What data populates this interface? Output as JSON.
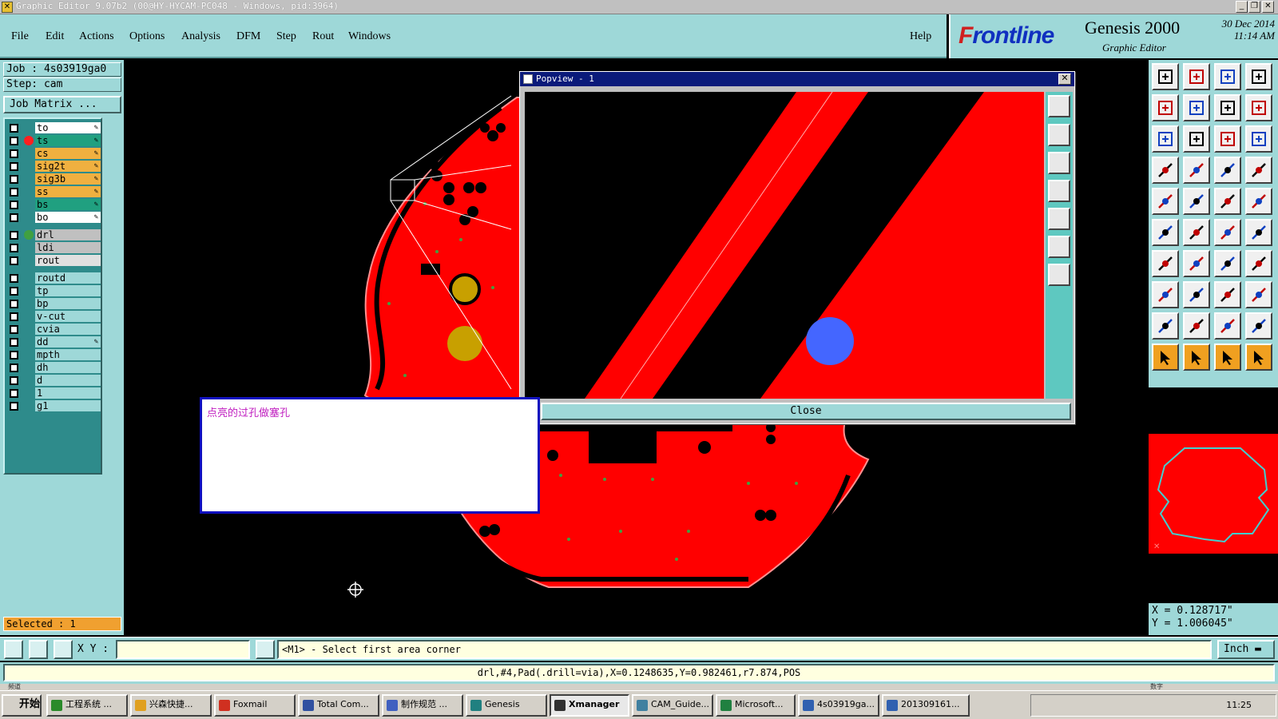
{
  "window": {
    "title": "Graphic Editor 9.07b2 (00@HY-HYCAM-PC048 - Windows, pid:3964)"
  },
  "menu": {
    "items": [
      "File",
      "Edit",
      "Actions",
      "Options",
      "Analysis",
      "DFM",
      "Step",
      "Rout",
      "Windows"
    ],
    "help": "Help"
  },
  "brand": {
    "logo_left": "F",
    "logo_right": "rontline",
    "product": "Genesis 2000",
    "subtitle": "Graphic Editor",
    "date": "30 Dec 2014",
    "time": "11:14 AM"
  },
  "left": {
    "job": "Job : 4s03919ga0",
    "step": "Step: cam",
    "job_matrix": "Job Matrix ...",
    "selected": "Selected : 1",
    "layers": [
      {
        "name": "to",
        "color": "#ffffff",
        "editable": true
      },
      {
        "name": "ts",
        "color": "#20a080",
        "editable": true,
        "marker": "#ff2020"
      },
      {
        "name": "cs",
        "color": "#f0b040",
        "editable": true
      },
      {
        "name": "sig2t",
        "color": "#f0b040",
        "editable": true
      },
      {
        "name": "sig3b",
        "color": "#f0b040",
        "editable": true
      },
      {
        "name": "ss",
        "color": "#f0b040",
        "editable": true
      },
      {
        "name": "bs",
        "color": "#20a080",
        "editable": true
      },
      {
        "name": "bo",
        "color": "#ffffff",
        "editable": true
      },
      {
        "name": "drl",
        "color": "#c0c0c0",
        "editable": false,
        "marker": "#40a040",
        "gap_before": true
      },
      {
        "name": "ldi",
        "color": "#c0c0c0",
        "editable": false
      },
      {
        "name": "rout",
        "color": "#e0e0e0",
        "editable": false
      },
      {
        "name": "routd",
        "color": "#9ed8d8",
        "editable": false,
        "gap_before": true
      },
      {
        "name": "tp",
        "color": "#9ed8d8",
        "editable": false
      },
      {
        "name": "bp",
        "color": "#9ed8d8",
        "editable": false
      },
      {
        "name": "v-cut",
        "color": "#9ed8d8",
        "editable": false
      },
      {
        "name": "cvia",
        "color": "#9ed8d8",
        "editable": false
      },
      {
        "name": "dd",
        "color": "#9ed8d8",
        "editable": true
      },
      {
        "name": "mpth",
        "color": "#9ed8d8",
        "editable": false
      },
      {
        "name": "dh",
        "color": "#9ed8d8",
        "editable": false
      },
      {
        "name": "d",
        "color": "#9ed8d8",
        "editable": false
      },
      {
        "name": "1",
        "color": "#9ed8d8",
        "editable": false
      },
      {
        "name": "g1",
        "color": "#9ed8d8",
        "editable": false
      }
    ]
  },
  "popview": {
    "title": "Popview - 1",
    "close_label": "Close",
    "close_x": "✕"
  },
  "message": {
    "text": "点亮的过孔做塞孔"
  },
  "coords": {
    "x": "X = 0.128717\"",
    "y": "Y = 1.006045\""
  },
  "command": {
    "xy_label": "X Y :",
    "xy_value": "",
    "prompt": "<M1> - Select first area corner",
    "unit": "Inch ▬",
    "status": "drl,#4,Pad(.drill=via),X=0.1248635,Y=0.982461,r7.874,POS"
  },
  "taskbar": {
    "start": "开始",
    "strip_left": "频道",
    "strip_right": "数字",
    "clock": "11:25",
    "items": [
      {
        "label": "工程系统 ...",
        "icon": "#2a8a2a"
      },
      {
        "label": "兴森快捷...",
        "icon": "#e0a020"
      },
      {
        "label": "Foxmail",
        "icon": "#d03020"
      },
      {
        "label": "Total Com...",
        "icon": "#3050a0"
      },
      {
        "label": "制作规范 ...",
        "icon": "#4060c0"
      },
      {
        "label": "Genesis",
        "icon": "#208080"
      },
      {
        "label": "Xmanager",
        "icon": "#303030",
        "active": true
      },
      {
        "label": "CAM_Guide...",
        "icon": "#4080a0"
      },
      {
        "label": "Microsoft...",
        "icon": "#208040"
      },
      {
        "label": "4s03919ga...",
        "icon": "#3060b0"
      },
      {
        "label": "201309161...",
        "icon": "#3060b0"
      }
    ]
  }
}
